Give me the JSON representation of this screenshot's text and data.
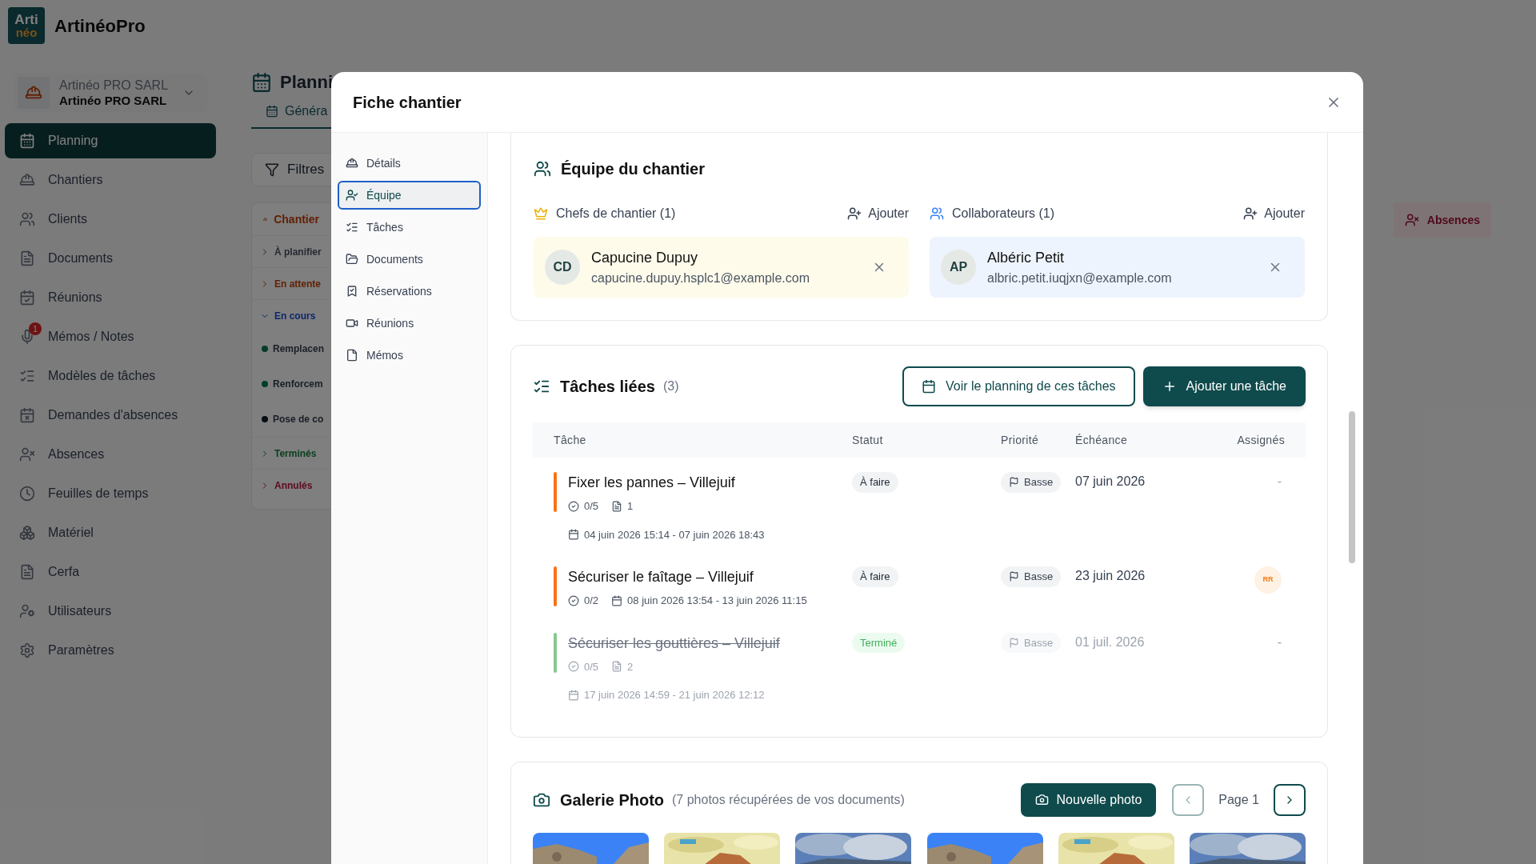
{
  "app": {
    "name": "ArtinéoPro",
    "logo_top": "Arti",
    "logo_bottom": "néo"
  },
  "company": {
    "name": "Artinéo PRO SARL",
    "subtitle": "Artinéo PRO SARL"
  },
  "sidebar": {
    "items": [
      {
        "label": "Planning",
        "selected": true
      },
      {
        "label": "Chantiers",
        "selected": false
      },
      {
        "label": "Clients",
        "selected": false
      },
      {
        "label": "Documents",
        "selected": false
      },
      {
        "label": "Réunions",
        "selected": false
      },
      {
        "label": "Mémos / Notes",
        "selected": false,
        "badge": "1"
      },
      {
        "label": "Modèles de tâches",
        "selected": false
      },
      {
        "label": "Demandes d'absences",
        "selected": false
      },
      {
        "label": "Absences",
        "selected": false
      },
      {
        "label": "Feuilles de temps",
        "selected": false
      },
      {
        "label": "Matériel",
        "selected": false
      },
      {
        "label": "Cerfa",
        "selected": false
      },
      {
        "label": "Utilisateurs",
        "selected": false
      },
      {
        "label": "Paramètres",
        "selected": false
      }
    ]
  },
  "page": {
    "title": "Planni",
    "tab": "Généra",
    "filters": "Filtres",
    "panel_title": "Chantier",
    "groups": [
      {
        "label": "À planifier",
        "color": "#252a31",
        "expanded": false
      },
      {
        "label": "En attente",
        "color": "#612006",
        "expanded": false
      },
      {
        "label": "En cours",
        "color": "#0e276c",
        "expanded": true,
        "children": [
          {
            "label": "Remplacen",
            "color": "#023c2b"
          },
          {
            "label": "Renforcem",
            "color": "#023c2b"
          },
          {
            "label": "Pose de co",
            "color": "#080c13"
          }
        ]
      },
      {
        "label": "Terminés",
        "color": "#0a401e",
        "expanded": false
      },
      {
        "label": "Annulés",
        "color": "#5f091e",
        "expanded": false
      }
    ],
    "absences_chip": "Absences"
  },
  "modal": {
    "title": "Fiche chantier",
    "nav": [
      {
        "label": "Détails",
        "selected": false
      },
      {
        "label": "Équipe",
        "selected": true
      },
      {
        "label": "Tâches",
        "selected": false
      },
      {
        "label": "Documents",
        "selected": false
      },
      {
        "label": "Réservations",
        "selected": false
      },
      {
        "label": "Réunions",
        "selected": false
      },
      {
        "label": "Mémos",
        "selected": false
      }
    ],
    "team": {
      "title": "Équipe du chantier",
      "groups": [
        {
          "kind": "chefs",
          "label": "Chefs de chantier (1)",
          "add": "Ajouter",
          "members": [
            {
              "initials": "CD",
              "name": "Capucine Dupuy",
              "email": "capucine.dupuy.hsplc1@example.com"
            }
          ]
        },
        {
          "kind": "collaborateurs",
          "label": "Collaborateurs (1)",
          "add": "Ajouter",
          "members": [
            {
              "initials": "AP",
              "name": "Albéric Petit",
              "email": "albric.petit.iuqjxn@example.com"
            }
          ]
        }
      ]
    },
    "tasks": {
      "title": "Tâches liées",
      "count": "(3)",
      "view_button": "Voir le planning de ces tâches",
      "add_button": "Ajouter une tâche",
      "columns": [
        "Tâche",
        "Statut",
        "Priorité",
        "Échéance",
        "Assignés"
      ],
      "rows": [
        {
          "title": "Fixer les pannes – Villejuif",
          "done": false,
          "color": "#f97316",
          "checklist": "0/5",
          "docs": "1",
          "dates": "04 juin 2026 15:14 - 07 juin 2026 18:43",
          "status": "À faire",
          "priority": "Basse",
          "due": "07 juin 2026",
          "assignee": {
            "kind": "none",
            "text": "-"
          }
        },
        {
          "title": "Sécuriser le faîtage – Villejuif",
          "done": false,
          "color": "#f97316",
          "checklist": "0/2",
          "dates": "08 juin 2026 13:54 - 13 juin 2026 11:15",
          "status": "À faire",
          "priority": "Basse",
          "due": "23 juin 2026",
          "assignee": {
            "kind": "avatar",
            "text": "RR"
          }
        },
        {
          "title": "Sécuriser les gouttières – Villejuif",
          "done": true,
          "color": "#86c98e",
          "checklist": "0/5",
          "docs": "2",
          "dates": "17 juin 2026 14:59 - 21 juin 2026 12:12",
          "status": "Terminé",
          "priority": "Basse",
          "due": "01 juil. 2026",
          "assignee": {
            "kind": "none",
            "text": "-"
          }
        }
      ]
    },
    "gallery": {
      "title": "Galerie Photo",
      "subtitle": "(7 photos récupérées de vos documents)",
      "new_button": "Nouvelle photo",
      "page": "Page 1",
      "prev_disabled": true,
      "next_disabled": false
    }
  }
}
